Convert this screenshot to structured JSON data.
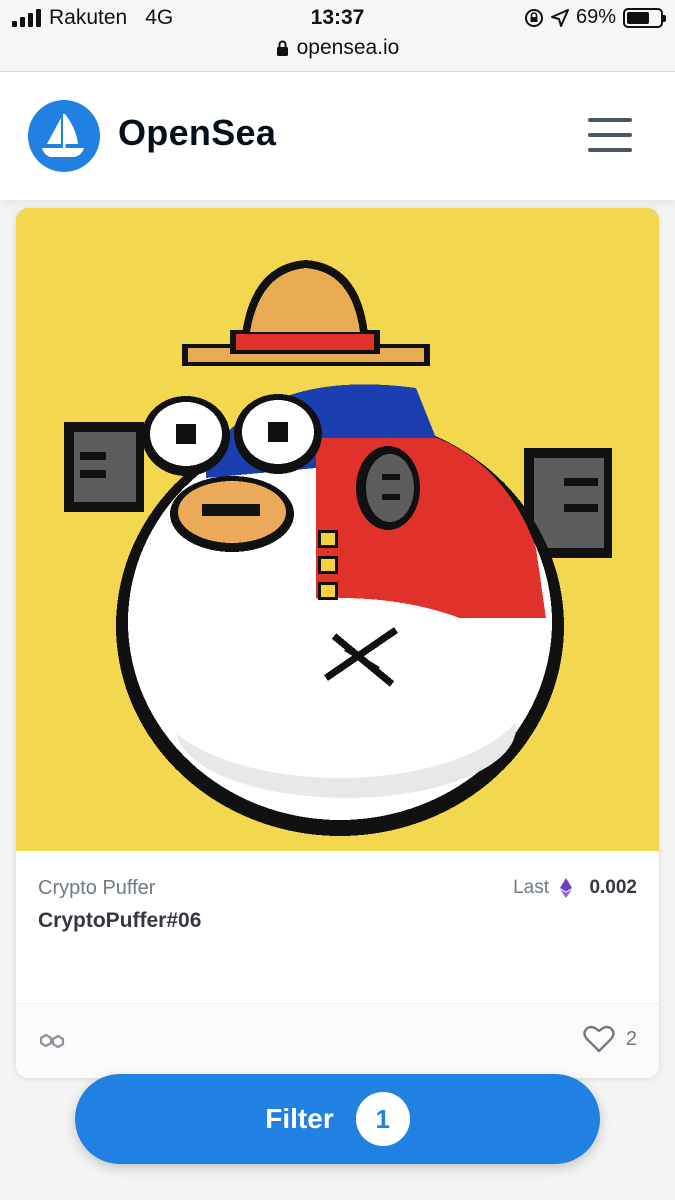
{
  "status_bar": {
    "carrier": "Rakuten",
    "network": "4G",
    "time": "13:37",
    "battery": "69%",
    "battery_level": 0.69,
    "url": "opensea.io",
    "icons": [
      "signal-bars-icon",
      "orientation-lock-icon",
      "location-arrow-icon",
      "battery-icon",
      "lock-icon"
    ]
  },
  "header": {
    "brand": "OpenSea",
    "logo_icon": "opensea-ship-logo",
    "menu_icon": "hamburger-menu-icon",
    "accent_color": "#2081e2"
  },
  "nft_card": {
    "image_description_icon": "crypto-puffer-pixel-art",
    "image_background": "#f2d74f",
    "collection": "Crypto Puffer",
    "name": "CryptoPuffer#06",
    "price_label": "Last",
    "price_currency_icon": "ethereum-icon",
    "price": "0.002",
    "chain_icon": "polygon-chain-icon",
    "like_icon": "heart-icon",
    "likes": "2"
  },
  "filter_button": {
    "label": "Filter",
    "count": "1"
  }
}
